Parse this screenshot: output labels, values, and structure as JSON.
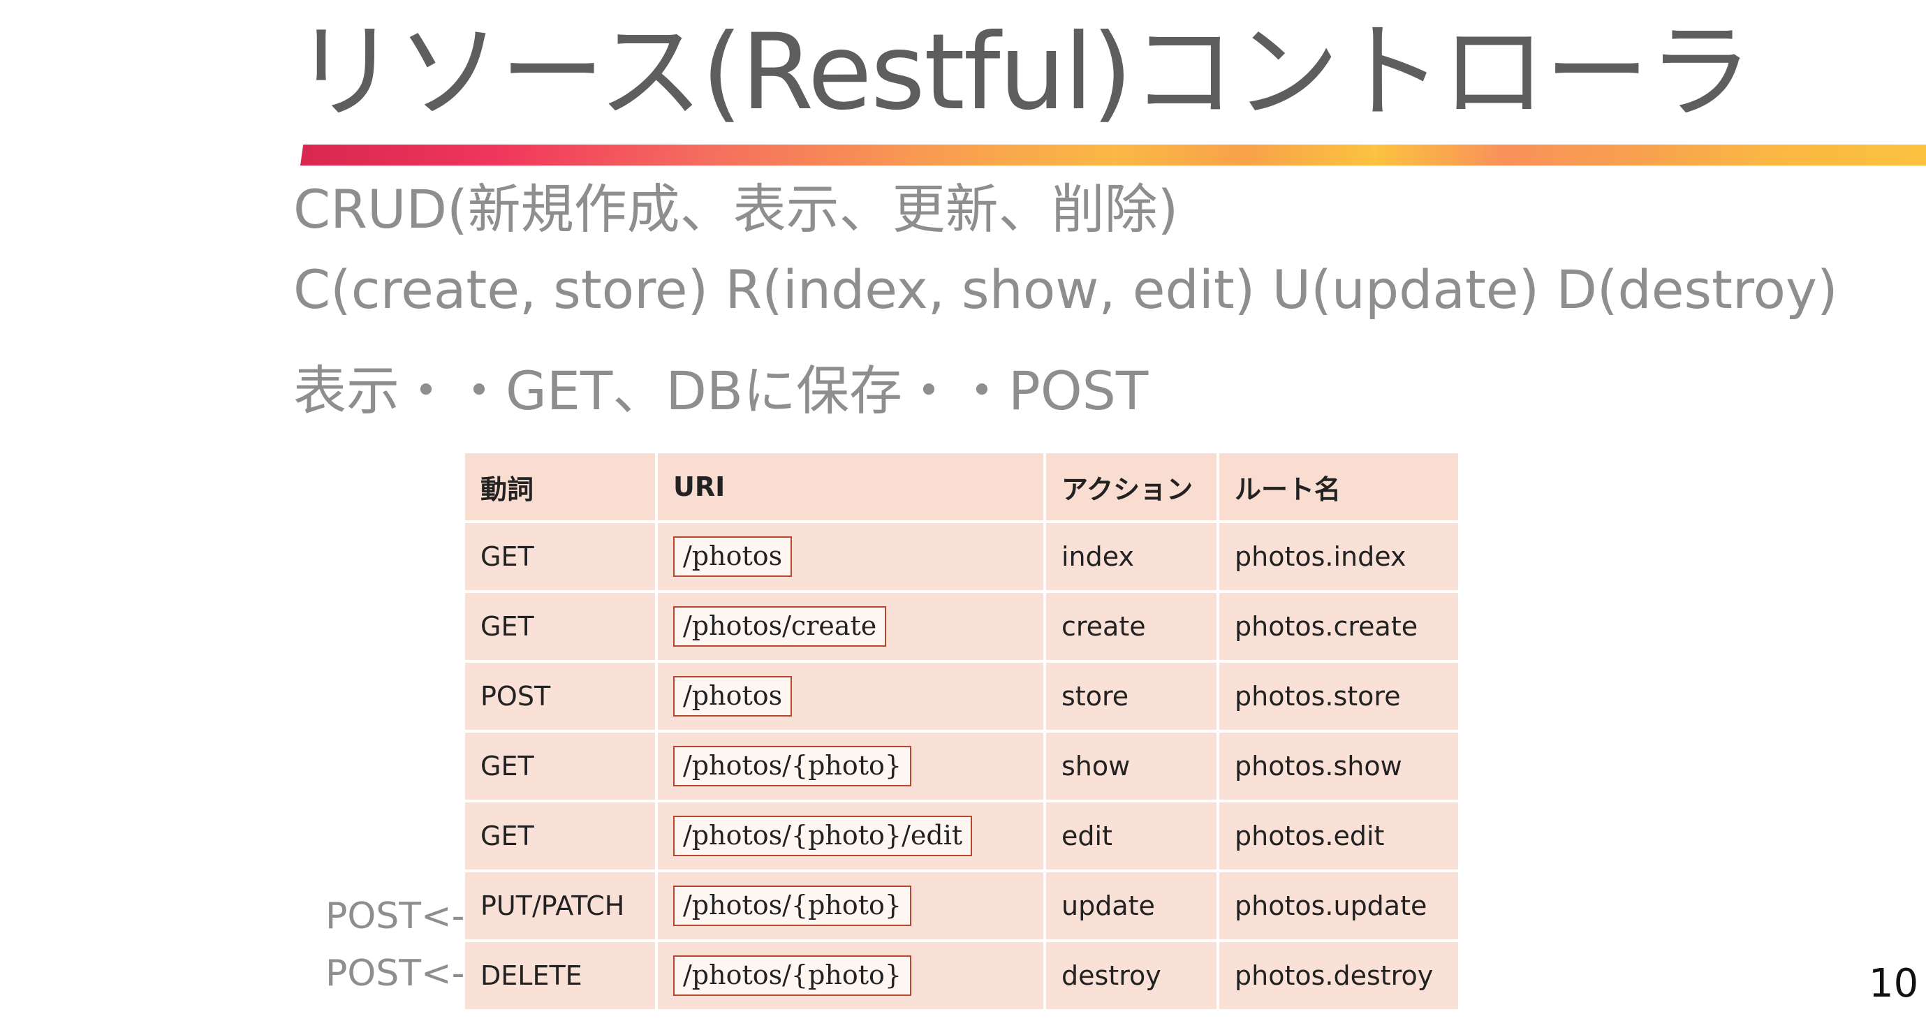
{
  "slide": {
    "title": "リソース(Restful)コントローラ",
    "bullets": [
      "CRUD(新規作成、表示、更新、削除)",
      "C(create, store) R(index, show, edit) U(update) D(destroy)",
      "表示・・GET、DBに保存・・POST"
    ],
    "page_number": "10",
    "accent_colors": [
      "#d8284f",
      "#f0365c",
      "#f89a52",
      "#fbc23f"
    ]
  },
  "table": {
    "headers": [
      "動詞",
      "URI",
      "アクション",
      "ルート名"
    ],
    "rows": [
      [
        "GET",
        "/photos",
        "index",
        "photos.index"
      ],
      [
        "GET",
        "/photos/create",
        "create",
        "photos.create"
      ],
      [
        "POST",
        "/photos",
        "store",
        "photos.store"
      ],
      [
        "GET",
        "/photos/{photo}",
        "show",
        "photos.show"
      ],
      [
        "GET",
        "/photos/{photo}/edit",
        "edit",
        "photos.edit"
      ],
      [
        "PUT/PATCH",
        "/photos/{photo}",
        "update",
        "photos.update"
      ],
      [
        "DELETE",
        "/photos/{photo}",
        "destroy",
        "photos.destroy"
      ]
    ]
  },
  "notes": {
    "update_note": "POST<-",
    "destroy_note": "POST<-"
  }
}
